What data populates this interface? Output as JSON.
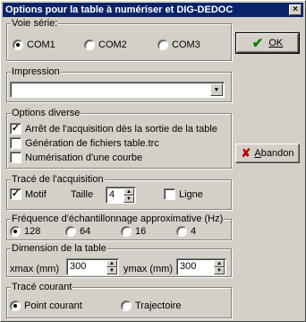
{
  "window": {
    "title": "Options pour la table à numériser et DIG-DEDOC",
    "close": "×"
  },
  "voie_serie": {
    "title": "Voie série:",
    "options": [
      {
        "label": "COM1",
        "selected": true
      },
      {
        "label": "COM2",
        "selected": false
      },
      {
        "label": "COM3",
        "selected": false
      }
    ]
  },
  "impression": {
    "title": "Impression",
    "value": ""
  },
  "options_diverse": {
    "title": "Options diverse",
    "items": [
      {
        "label": "Arrêt de l'acquisition dès la sortie de la table",
        "checked": true
      },
      {
        "label": "Génération de fichiers table.trc",
        "checked": false
      },
      {
        "label": "Numérisation d'une courbe",
        "checked": false
      }
    ]
  },
  "trace_acquisition": {
    "title": "Tracé de l'acquisition",
    "motif_label": "Motif",
    "motif_checked": true,
    "taille_label": "Taille",
    "taille_value": "4",
    "ligne_label": "Ligne",
    "ligne_checked": false
  },
  "frequence": {
    "title": "Fréquence d'échantillonnage approximative (Hz)",
    "options": [
      {
        "label": "128",
        "selected": true
      },
      {
        "label": "64",
        "selected": false
      },
      {
        "label": "16",
        "selected": false
      },
      {
        "label": "4",
        "selected": false
      }
    ]
  },
  "dimension": {
    "title": "Dimension de la table",
    "xmax_label": "xmax (mm)",
    "xmax_value": "300",
    "ymax_label": "ymax (mm)",
    "ymax_value": "300"
  },
  "trace_courant": {
    "title": "Tracé courant",
    "options": [
      {
        "label": "Point courant",
        "selected": true
      },
      {
        "label": "Trajectoire",
        "selected": false
      }
    ]
  },
  "buttons": {
    "ok_label": "OK",
    "abandon_prefix": "",
    "abandon_label": "Abandon"
  },
  "colors": {
    "titlebar": "#0a246a",
    "face": "#d4d0c8",
    "ok_icon": "#008000",
    "cancel_icon": "#c00000"
  }
}
